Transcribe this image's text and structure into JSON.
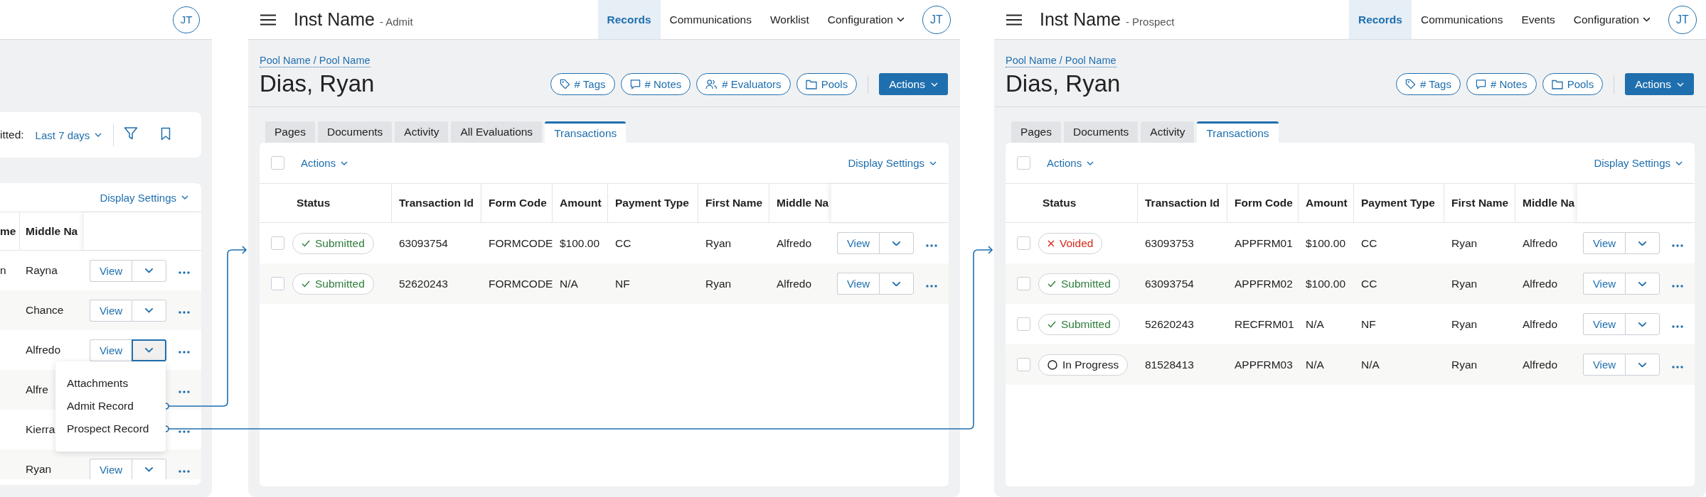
{
  "list_screen": {
    "avatar": "JT",
    "filter_label": "itted:",
    "date_filter": "Last 7 days",
    "display_settings": "Display Settings",
    "columns": [
      "me",
      "Middle Na"
    ],
    "rows": [
      {
        "column_1": "n",
        "middle_name": "Rayna",
        "view": "View",
        "menu_open": false
      },
      {
        "middle_name": "Chance",
        "view": "View",
        "menu_open": false
      },
      {
        "middle_name": "Alfredo",
        "view": "View",
        "menu_open": true
      },
      {
        "middle_name": "Alfre",
        "menu_open": false
      },
      {
        "middle_name": "Kierra",
        "menu_open": false
      },
      {
        "middle_name": "Ryan",
        "view": "View",
        "menu_open": false
      }
    ],
    "dropdown_menu": [
      "Attachments",
      "Admit Record",
      "Prospect Record"
    ]
  },
  "record_screens": [
    {
      "app_name": "Inst Name",
      "app_context": "- Admit",
      "avatar": "JT",
      "nav": [
        {
          "label": "Records",
          "selected": true,
          "dropdown": false
        },
        {
          "label": "Communications",
          "selected": false,
          "dropdown": false
        },
        {
          "label": "Worklist",
          "selected": false,
          "dropdown": false
        },
        {
          "label": "Configuration",
          "selected": false,
          "dropdown": true
        }
      ],
      "breadcrumb": "Pool Name / Pool Name",
      "title": "Dias, Ryan",
      "header_buttons": [
        {
          "kind": "tags",
          "label": "# Tags"
        },
        {
          "kind": "notes",
          "label": "# Notes"
        },
        {
          "kind": "evaluators",
          "label": "# Evaluators"
        },
        {
          "kind": "pools",
          "label": "Pools"
        }
      ],
      "actions_button": "Actions",
      "tabs": [
        {
          "label": "Pages",
          "selected": false
        },
        {
          "label": "Documents",
          "selected": false
        },
        {
          "label": "Activity",
          "selected": false
        },
        {
          "label": "All Evaluations",
          "selected": false
        },
        {
          "label": "Transactions",
          "selected": true
        }
      ],
      "select_all_checked": false,
      "bulk_actions": "Actions",
      "display_settings": "Display Settings",
      "status_column": "Status",
      "columns": [
        "Transaction Id",
        "Form Code",
        "Amount",
        "Payment Type",
        "First Name",
        "Middle Na"
      ],
      "rows": [
        {
          "checked": false,
          "status": {
            "kind": "submitted",
            "label": "Submitted"
          },
          "cells": [
            "63093754",
            "FORMCODE",
            "$100.00",
            "CC",
            "Ryan",
            "Alfredo"
          ],
          "view": "View"
        },
        {
          "checked": false,
          "status": {
            "kind": "submitted",
            "label": "Submitted"
          },
          "cells": [
            "52620243",
            "FORMCODE",
            "N/A",
            "NF",
            "Ryan",
            "Alfredo"
          ],
          "view": "View"
        }
      ]
    },
    {
      "app_name": "Inst Name",
      "app_context": "- Prospect",
      "avatar": "JT",
      "nav": [
        {
          "label": "Records",
          "selected": true,
          "dropdown": false
        },
        {
          "label": "Communications",
          "selected": false,
          "dropdown": false
        },
        {
          "label": "Events",
          "selected": false,
          "dropdown": false
        },
        {
          "label": "Configuration",
          "selected": false,
          "dropdown": true
        }
      ],
      "breadcrumb": "Pool Name / Pool Name",
      "title": "Dias, Ryan",
      "header_buttons": [
        {
          "kind": "tags",
          "label": "# Tags"
        },
        {
          "kind": "notes",
          "label": "# Notes"
        },
        {
          "kind": "pools",
          "label": "Pools"
        }
      ],
      "actions_button": "Actions",
      "tabs": [
        {
          "label": "Pages",
          "selected": false
        },
        {
          "label": "Documents",
          "selected": false
        },
        {
          "label": "Activity",
          "selected": false
        },
        {
          "label": "Transactions",
          "selected": true
        }
      ],
      "select_all_checked": false,
      "bulk_actions": "Actions",
      "display_settings": "Display Settings",
      "status_column": "Status",
      "columns": [
        "Transaction Id",
        "Form Code",
        "Amount",
        "Payment Type",
        "First Name",
        "Middle Na"
      ],
      "rows": [
        {
          "checked": false,
          "status": {
            "kind": "voided",
            "label": "Voided"
          },
          "cells": [
            "63093753",
            "APPFRM01",
            "$100.00",
            "CC",
            "Ryan",
            "Alfredo"
          ],
          "view": "View"
        },
        {
          "checked": false,
          "status": {
            "kind": "submitted",
            "label": "Submitted"
          },
          "cells": [
            "63093754",
            "APPFRM02",
            "$100.00",
            "CC",
            "Ryan",
            "Alfredo"
          ],
          "view": "View"
        },
        {
          "checked": false,
          "status": {
            "kind": "submitted",
            "label": "Submitted"
          },
          "cells": [
            "52620243",
            "RECFRM01",
            "N/A",
            "NF",
            "Ryan",
            "Alfredo"
          ],
          "view": "View"
        },
        {
          "checked": false,
          "status": {
            "kind": "in_progress",
            "label": "In Progress"
          },
          "cells": [
            "81528413",
            "APPFRM03",
            "N/A",
            "N/A",
            "Ryan",
            "Alfredo"
          ],
          "view": "View"
        }
      ]
    }
  ]
}
